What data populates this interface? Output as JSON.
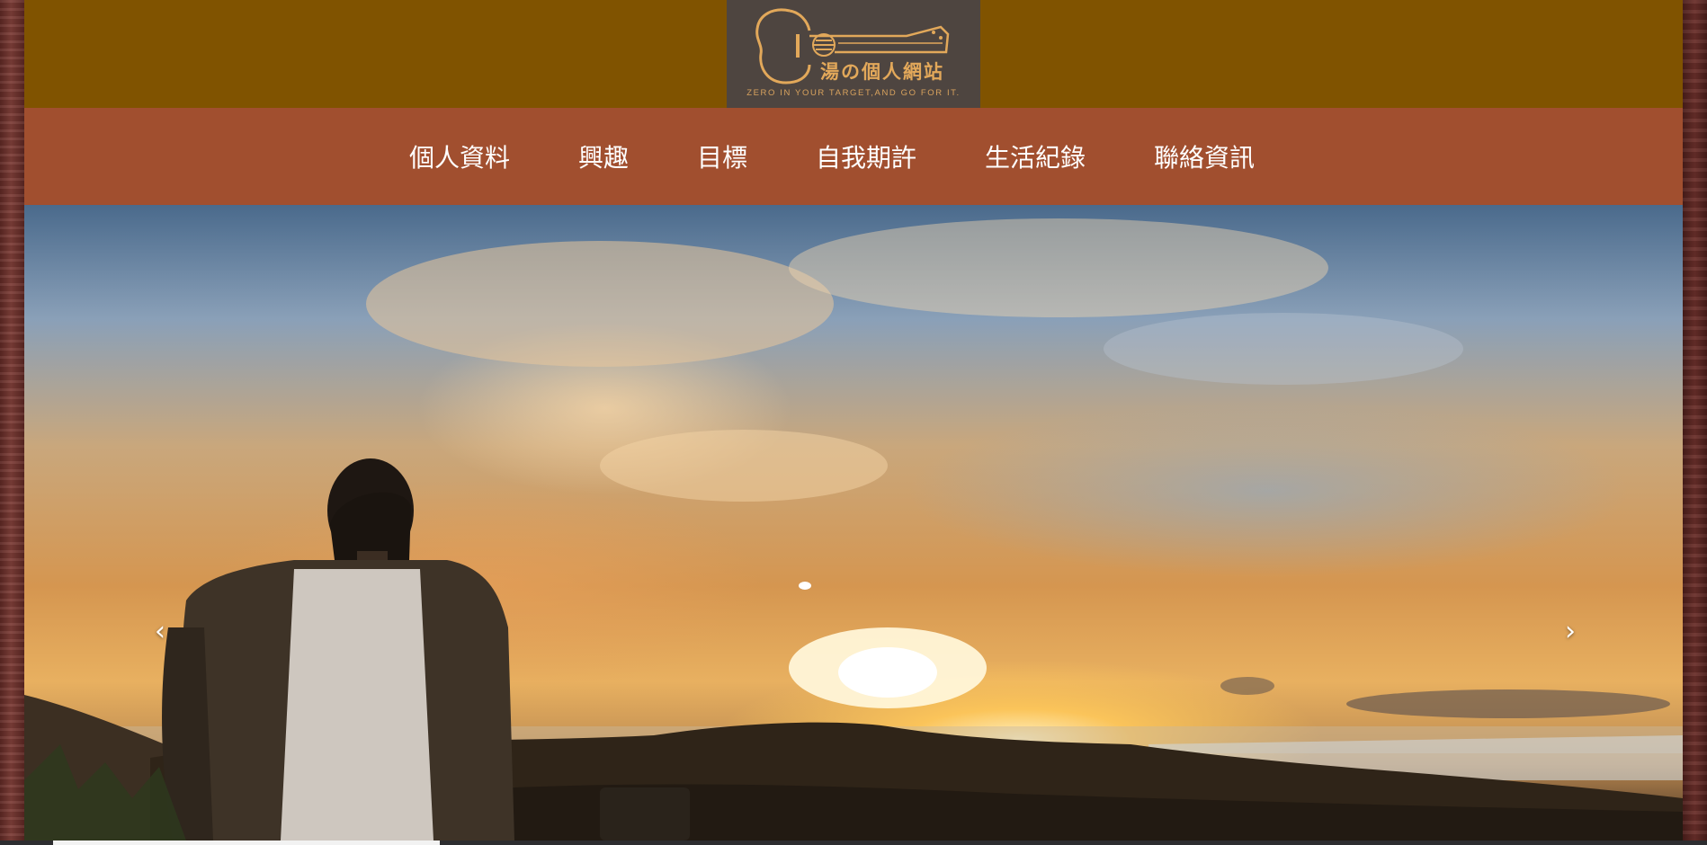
{
  "site": {
    "logo_title": "湯の個人網站",
    "logo_tagline": "ZERO IN YOUR TARGET,AND GO FOR IT."
  },
  "nav": {
    "items": [
      {
        "label": "個人資料"
      },
      {
        "label": "興趣"
      },
      {
        "label": "目標"
      },
      {
        "label": "自我期許"
      },
      {
        "label": "生活紀錄"
      },
      {
        "label": "聯絡資訊"
      }
    ]
  },
  "carousel": {
    "prev_icon": "chevron-left-icon",
    "next_icon": "chevron-right-icon",
    "prev_glyph": "‹",
    "next_glyph": "›",
    "slide_count": 1,
    "active_slide": 1
  },
  "colors": {
    "topbar": "#805300",
    "logo_bg": "#4e4540",
    "logo_accent": "#e2a85a",
    "navbar": "#a14f2f",
    "nav_text": "#ffffff"
  }
}
